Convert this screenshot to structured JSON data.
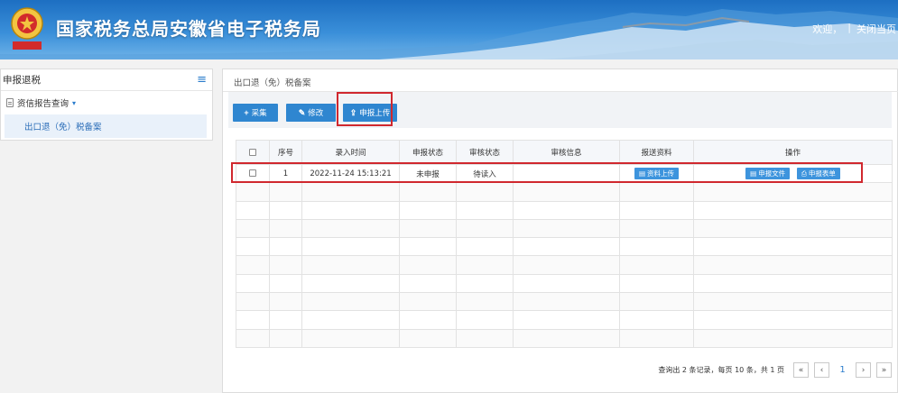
{
  "header": {
    "title": "国家税务总局安徽省电子税务局",
    "welcome": "欢迎，",
    "separator": "|",
    "close_page": "关闭当页"
  },
  "sidebar": {
    "title": "申报退税",
    "group": "资信报告查询",
    "item": "出口退（免）税备案"
  },
  "main": {
    "breadcrumb": "出口退（免）税备案",
    "toolbar": {
      "collect": "采集",
      "edit": "修改",
      "upload": "申报上传"
    },
    "table": {
      "headers": [
        "序号",
        "录入时间",
        "申报状态",
        "审核状态",
        "审核信息",
        "报送资料",
        "操作"
      ],
      "rows": [
        {
          "index": "1",
          "time": "2022-11-24 15:13:21",
          "declare_status": "未申报",
          "audit_status": "待读入",
          "audit_info": "",
          "submit_button": "资料上传",
          "file_button": "申报文件",
          "form_button": "申报表单"
        }
      ]
    },
    "pager": {
      "info": "查询出 2 条记录，每页 10 条，共 1 页",
      "first": "«",
      "prev": "‹",
      "current": "1",
      "next": "›",
      "last": "»"
    }
  },
  "colors": {
    "header_blue": "#1d6fc2",
    "button_blue": "#2f86d0",
    "highlight_red": "#d0282e"
  }
}
